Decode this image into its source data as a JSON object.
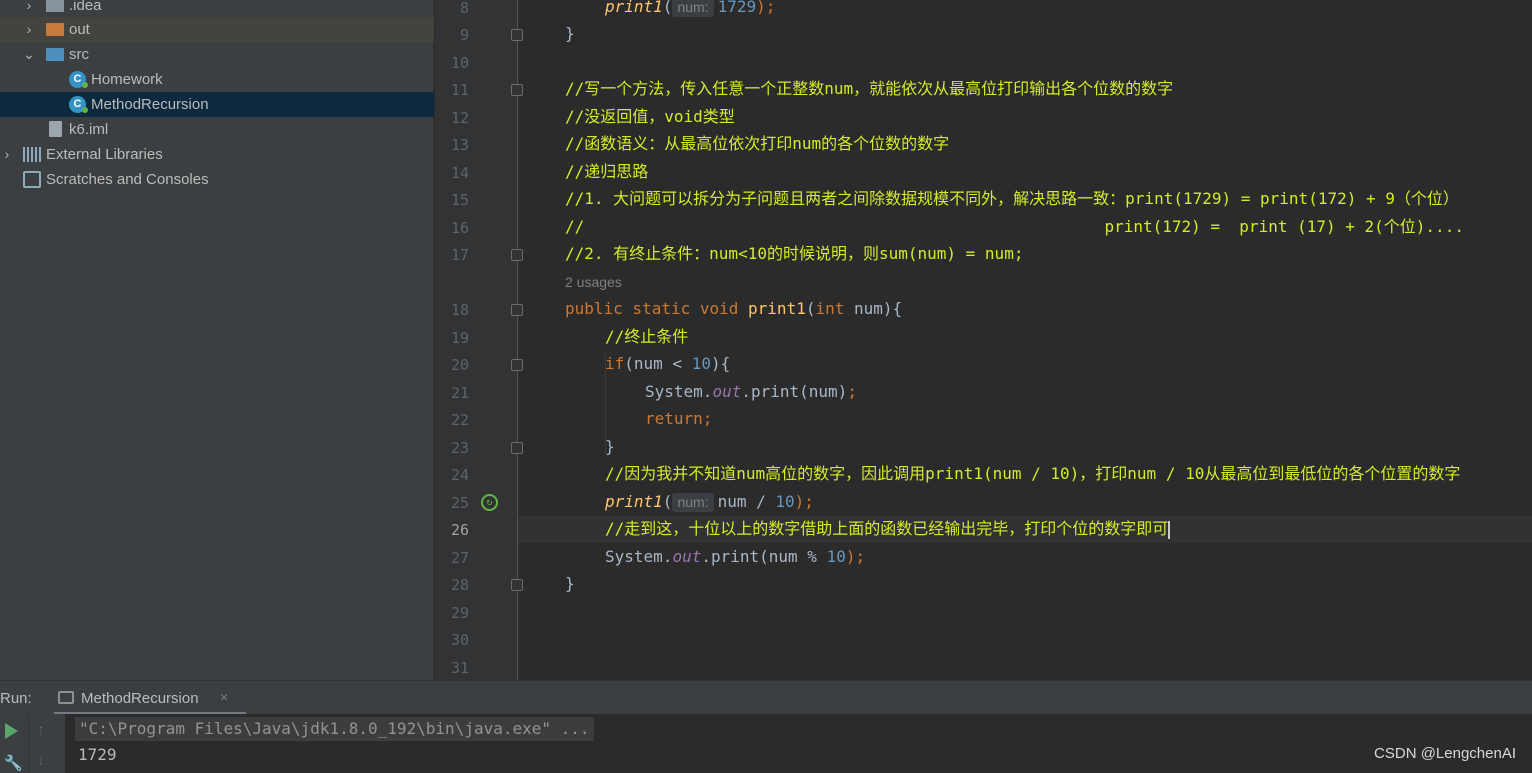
{
  "sidebar": {
    "items": [
      {
        "label": ".idea",
        "icon": "folder-icon"
      },
      {
        "label": "out",
        "icon": "folder-icon"
      },
      {
        "label": "src",
        "icon": "folder-icon"
      },
      {
        "label": "Homework",
        "icon": "java-class-icon"
      },
      {
        "label": "MethodRecursion",
        "icon": "java-class-icon"
      },
      {
        "label": "k6.iml",
        "icon": "file-icon"
      },
      {
        "label": "External Libraries",
        "icon": "library-icon"
      },
      {
        "label": "Scratches and Consoles",
        "icon": "scratch-icon"
      }
    ]
  },
  "editor": {
    "line_numbers": [
      "8",
      "9",
      "10",
      "11",
      "12",
      "13",
      "14",
      "15",
      "16",
      "17",
      "18",
      "19",
      "20",
      "21",
      "22",
      "23",
      "24",
      "25",
      "26",
      "27",
      "28",
      "29",
      "30",
      "31"
    ],
    "current_line": "26",
    "usages_hint": "2 usages",
    "param_hint": "num:",
    "lines": {
      "l8_fn": "print1",
      "l8_open": "(",
      "l8_num": "1729",
      "l8_close": ");",
      "l9": "}",
      "l11": "//写一个方法，传入任意一个正整数num，就能依次从最高位打印输出各个位数的数字",
      "l12": "//没返回值，void类型",
      "l13": "//函数语义：从最高位依次打印num的各个位数的数字",
      "l14": "//递归思路",
      "l15": "//1. 大问题可以拆分为子问题且两者之间除数据规模不同外，解决思路一致：print(1729) = print(172) + 9（个位）",
      "l16": "//                                                      print(172) =  print (17) + 2(个位)....",
      "l17": "//2. 有终止条件：num<10的时候说明，则sum(num) = num;",
      "l18_kw": "public static void ",
      "l18_fn": "print1",
      "l18_a": "(",
      "l18_kw2": "int",
      "l18_b": " num){",
      "l19": "//终止条件",
      "l20_kw": "if",
      "l20_a": "(num < ",
      "l20_num": "10",
      "l20_b": "){",
      "l21_a": "System.",
      "l21_field": "out",
      "l21_b": ".print(num)",
      "l21_c": ";",
      "l22": "return;",
      "l23": "}",
      "l24": "//因为我并不知道num高位的数字，因此调用print1(num / 10)，打印num / 10从最高位到最低位的各个位置的数字",
      "l25_fn": "print1",
      "l25_open": "(",
      "l25_a": "num / ",
      "l25_num": "10",
      "l25_close": ");",
      "l26": "//走到这，十位以上的数字借助上面的函数已经输出完毕，打印个位的数字即可",
      "l27_a": "System.",
      "l27_field": "out",
      "l27_b": ".print(num % ",
      "l27_num": "10",
      "l27_c": ");",
      "l28": "}"
    }
  },
  "run_panel": {
    "title": "Run:",
    "tab_label": "MethodRecursion",
    "tab_close": "×",
    "command": "\"C:\\Program Files\\Java\\jdk1.8.0_192\\bin\\java.exe\" ...",
    "output": "1729"
  },
  "watermark": "CSDN @LengchenAI",
  "colors": {
    "comment": "#d4ec28",
    "keyword": "#cc7832",
    "function": "#ffc66d",
    "number": "#6897bb",
    "selection": "#0d293e"
  }
}
